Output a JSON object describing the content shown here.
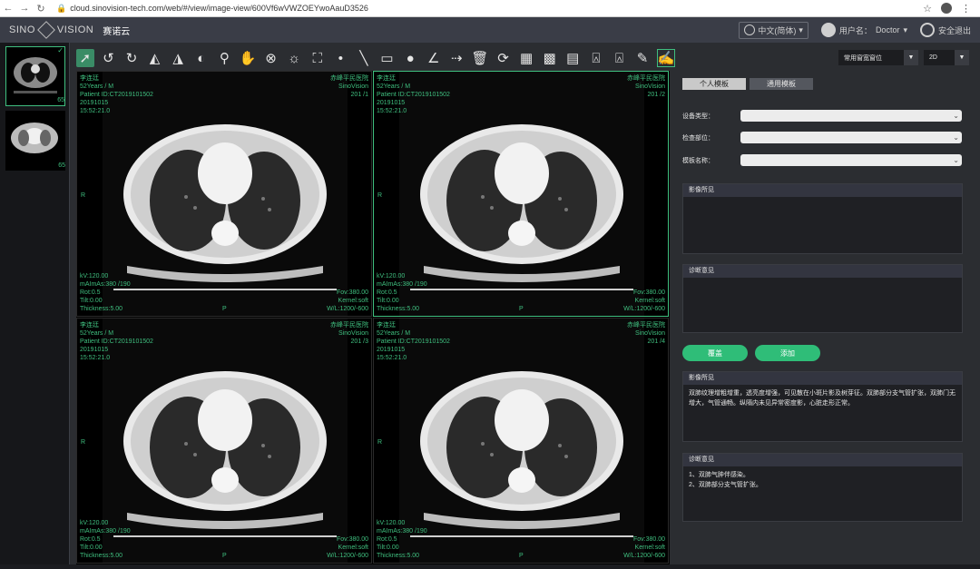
{
  "browser": {
    "url": "cloud.sinovision-tech.com/web/#/view/image-view/600Vf6wVWZOEYwoAauD3526"
  },
  "header": {
    "logo_left": "SINO",
    "logo_right": "VISION",
    "app_title": "赛诺云",
    "language": "中文(简体)",
    "user_label": "用户名：",
    "user_name": "Doctor",
    "logout_label": "安全退出"
  },
  "thumbnails": [
    {
      "count": "65",
      "active": true
    },
    {
      "count": "65",
      "active": false
    }
  ],
  "toolbar": {
    "tools": [
      "pointer",
      "rotate-left",
      "rotate-right",
      "flip-horizontal",
      "flip-vertical",
      "invert",
      "zoom",
      "pan",
      "magnify-loupe",
      "window-level",
      "fit",
      "point",
      "line",
      "rectangle",
      "ellipse",
      "angle",
      "arrow",
      "delete",
      "reset",
      "layout-3x3",
      "layout-grid",
      "report",
      "stamp-1",
      "stamp-2",
      "clear",
      "edit-report"
    ]
  },
  "viewer": {
    "panes": [
      {
        "name": "李连廷",
        "age_sex": "52Years / M",
        "patient_id": "Patient ID:CT2019101502",
        "date": "20191015",
        "time": "15:52:21.0",
        "hospital": "赤峰平民医院",
        "vendor": "SinoVision",
        "slice": "201 /1",
        "kv": "kV:120.00",
        "mas": "mAImAs:380 /190",
        "rot": "Rot:0.5",
        "tilt": "Tilt:0.00",
        "thickness": "Thickness:5.00",
        "fov": "Fov:380.00",
        "kernel": "Kernel:soft",
        "wl": "W/L:1200/-600",
        "side": "R",
        "posterior": "P"
      },
      {
        "name": "李连廷",
        "age_sex": "52Years / M",
        "patient_id": "Patient ID:CT2019101502",
        "date": "20191015",
        "time": "15:52:21.0",
        "hospital": "赤峰平民医院",
        "vendor": "SinoVision",
        "slice": "201 /2",
        "kv": "kV:120.00",
        "mas": "mAImAs:380 /190",
        "rot": "Rot:0.5",
        "tilt": "Tilt:0.00",
        "thickness": "Thickness:5.00",
        "fov": "Fov:380.00",
        "kernel": "Kernel:soft",
        "wl": "W/L:1200/-600",
        "side": "R",
        "posterior": "P"
      },
      {
        "name": "李连廷",
        "age_sex": "52Years / M",
        "patient_id": "Patient ID:CT2019101502",
        "date": "20191015",
        "time": "15:52:21.0",
        "hospital": "赤峰平民医院",
        "vendor": "SinoVision",
        "slice": "201 /3",
        "kv": "kV:120.00",
        "mas": "mAImAs:380 /190",
        "rot": "Rot:0.5",
        "tilt": "Tilt:0.00",
        "thickness": "Thickness:5.00",
        "fov": "Fov:380.00",
        "kernel": "Kernel:soft",
        "wl": "W/L:1200/-600",
        "side": "R",
        "posterior": "P"
      },
      {
        "name": "李连廷",
        "age_sex": "52Years / M",
        "patient_id": "Patient ID:CT2019101502",
        "date": "20191015",
        "time": "15:52:21.0",
        "hospital": "赤峰平民医院",
        "vendor": "SinoVision",
        "slice": "201 /4",
        "kv": "kV:120.00",
        "mas": "mAImAs:380 /190",
        "rot": "Rot:0.5",
        "tilt": "Tilt:0.00",
        "thickness": "Thickness:5.00",
        "fov": "Fov:380.00",
        "kernel": "Kernel:soft",
        "wl": "W/L:1200/-600",
        "side": "R",
        "posterior": "P"
      }
    ]
  },
  "right_panel": {
    "preset_label": "常用窗宽窗位",
    "mode_value": "2D",
    "tabs": [
      "个人模板",
      "通用模板"
    ],
    "device_type_label": "设备类型：",
    "body_part_label": "检查部位：",
    "template_name_label": "模板名称：",
    "findings_template_head": "影像所见",
    "impression_template_head": "诊断意见",
    "overwrite_button": "覆盖",
    "add_button": "添加",
    "findings_head": "影像所见",
    "findings_text": "双肺纹理增粗增重，透亮度增强，可见散在小斑片影及树芽征。双肺部分支气管扩张，双肺门无增大，气管通畅。纵隔内未见异常密度影，心脏走形正常。",
    "impression_head": "诊断意见",
    "impression_lines": [
      "1、双肺气肿伴感染。",
      "2、双肺部分支气管扩张。"
    ]
  },
  "colors": {
    "accent": "#3fbf7f",
    "button": "#2fbd78",
    "panel_bg": "#2b2d31",
    "header_bg": "#3a3d47"
  }
}
